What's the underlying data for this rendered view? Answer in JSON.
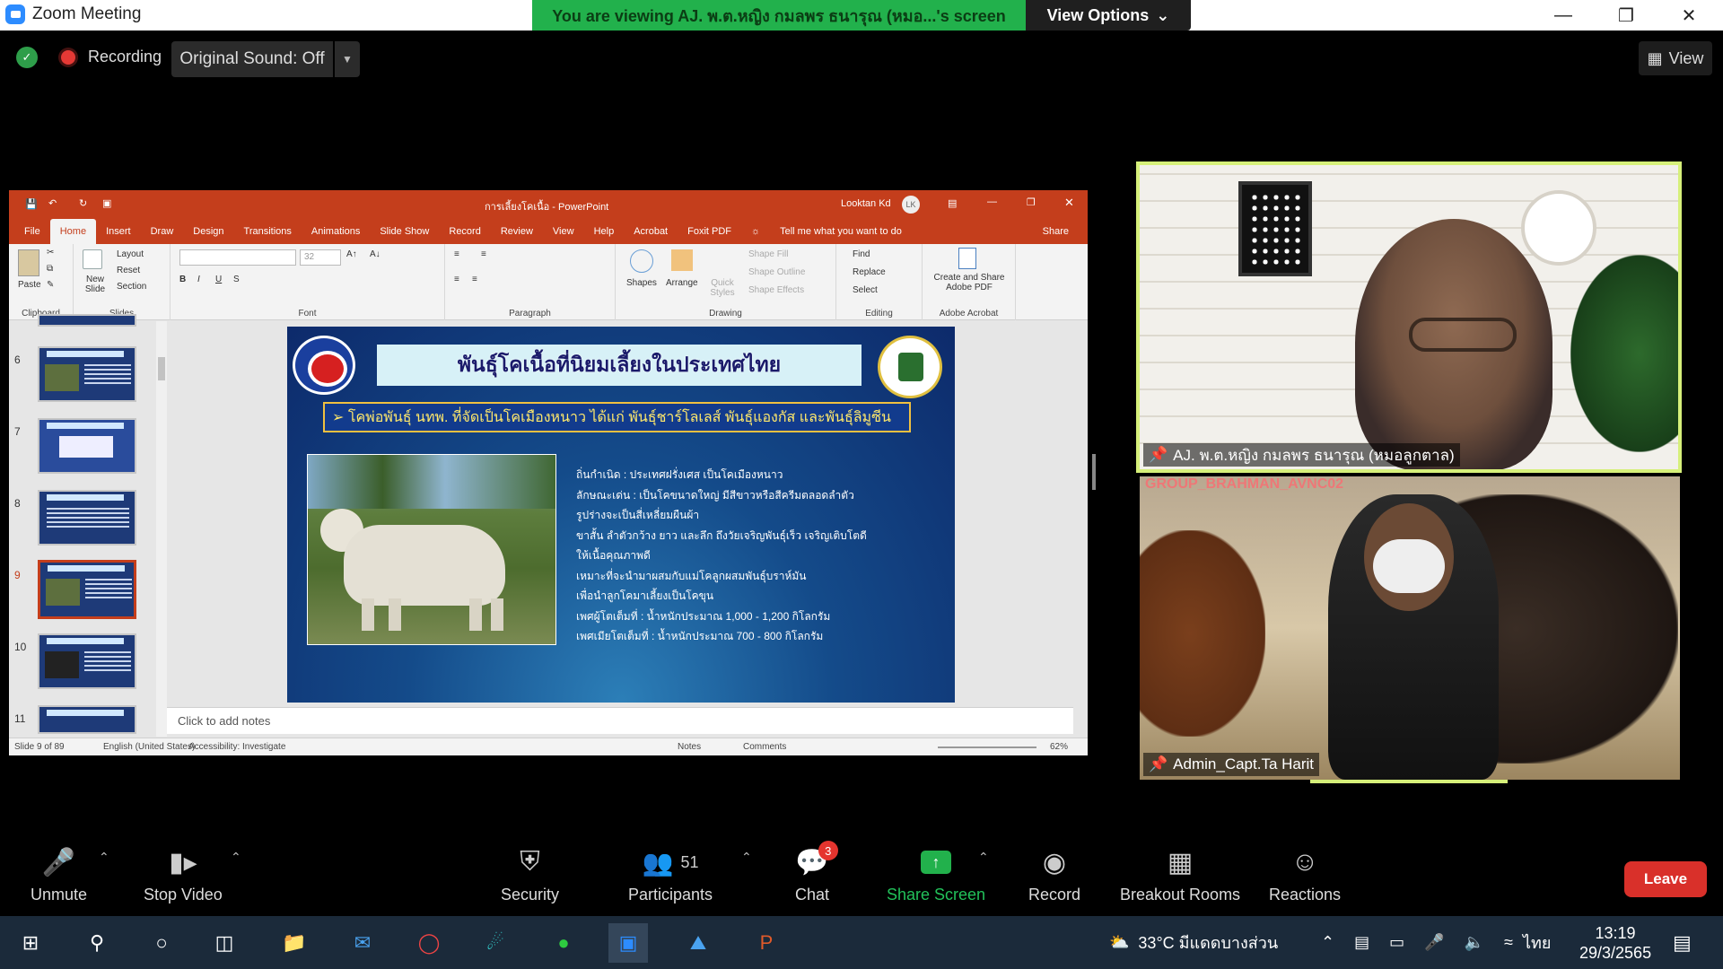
{
  "titlebar": {
    "app_title": "Zoom Meeting",
    "viewing_banner": "You are viewing AJ. พ.ต.หญิง กมลพร ธนารุณ (หมอ...'s screen",
    "view_options": "View Options"
  },
  "topbar": {
    "recording": "Recording",
    "original_sound": "Original Sound: Off",
    "view": "View"
  },
  "powerpoint": {
    "window_title": "การเลี้ยงโคเนื้อ - PowerPoint",
    "user": "Looktan Kd",
    "user_initials": "LK",
    "tabs": [
      "File",
      "Home",
      "Insert",
      "Draw",
      "Design",
      "Transitions",
      "Animations",
      "Slide Show",
      "Record",
      "Review",
      "View",
      "Help",
      "Acrobat",
      "Foxit PDF"
    ],
    "tell_me": "Tell me what you want to do",
    "share": "Share",
    "ribbon": {
      "paste": "Paste",
      "clipboard": "Clipboard",
      "new_slide": "New Slide",
      "layout": "Layout",
      "reset": "Reset",
      "section": "Section",
      "slides": "Slides",
      "font_size": "32",
      "font": "Font",
      "paragraph": "Paragraph",
      "shapes": "Shapes",
      "arrange": "Arrange",
      "quick_styles": "Quick Styles",
      "shape_fill": "Shape Fill",
      "shape_outline": "Shape Outline",
      "shape_effects": "Shape Effects",
      "drawing": "Drawing",
      "find": "Find",
      "replace": "Replace",
      "select": "Select",
      "editing": "Editing",
      "create_pdf": "Create and Share Adobe PDF",
      "adobe_acrobat": "Adobe Acrobat"
    },
    "thumbnail_numbers": [
      "6",
      "7",
      "8",
      "9",
      "10",
      "11"
    ],
    "slide": {
      "title": "พันธุ์โคเนื้อที่นิยมเลี้ยงในประเทศไทย",
      "subtitle": "➢ โคพ่อพันธุ์ นทพ. ที่จัดเป็นโคเมืองหนาว ได้แก่ พันธุ์ชาร์โลเลส์ พันธุ์แองกัส และพันธุ์ลิมูซีน",
      "text_lines": [
        "ถิ่นกำเนิด    :  ประเทศฝรั่งเศส เป็นโคเมืองหนาว",
        "ลักษณะเด่น  :  เป็นโคขนาดใหญ่ มีสีขาวหรือสีครีมตลอดลำตัว",
        "                    รูปร่างจะเป็นสี่เหลี่ยมผืนผ้า",
        "                    ขาสั้น ลำตัวกว้าง ยาว และลึก ถึงวัยเจริญพันธุ์เร็ว เจริญเติบโตดี",
        "                    ให้เนื้อคุณภาพดี",
        "                    เหมาะที่จะนำมาผสมกับแม่โคลูกผสมพันธุ์บราห์มัน",
        "                    เพื่อนำลูกโคมาเลี้ยงเป็นโคขุน",
        "เพศผู้โตเต็มที่     :  น้ำหนักประมาณ 1,000 - 1,200 กิโลกรัม",
        "เพศเมียโตเต็มที่  :  น้ำหนักประมาณ 700 - 800 กิโลกรัม"
      ]
    },
    "notes_placeholder": "Click to add notes",
    "status": {
      "slide_count": "Slide 9 of 89",
      "language": "English (United States)",
      "accessibility": "Accessibility: Investigate",
      "notes": "Notes",
      "comments": "Comments",
      "zoom": "62%"
    }
  },
  "videos": {
    "presenter_name": "AJ. พ.ต.หญิง กมลพร ธนารุณ (หมอลูกตาล)",
    "second_name": "Admin_Capt.Ta Harit",
    "second_overlay_text": "GROUP_BRAHMAN_AVNC02"
  },
  "toolbar": {
    "unmute": "Unmute",
    "stop_video": "Stop Video",
    "security": "Security",
    "participants": "Participants",
    "participants_count": "51",
    "chat": "Chat",
    "chat_badge": "3",
    "share_screen": "Share Screen",
    "record": "Record",
    "breakout_rooms": "Breakout Rooms",
    "reactions": "Reactions",
    "leave": "Leave"
  },
  "taskbar": {
    "weather": "33°C มีแดดบางส่วน",
    "language": "ไทย",
    "time": "13:19",
    "date": "29/3/2565"
  },
  "colors": {
    "zoom_green_banner": "#22b14c",
    "ppt_red": "#c43e1c",
    "leave_red": "#d9302a",
    "active_speaker": "#d6f07a",
    "share_green": "#22b14c"
  }
}
